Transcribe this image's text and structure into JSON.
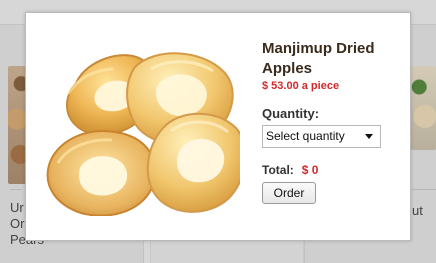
{
  "modal": {
    "product": {
      "title": "Manjimup Dried Apples",
      "price": "$ 53.00 a piece",
      "image_alt": "dried apple rings"
    },
    "quantity": {
      "label": "Quantity:",
      "placeholder": "Select quantity"
    },
    "total": {
      "label": "Total:",
      "value": "$ 0"
    },
    "order_button": "Order"
  },
  "background": {
    "left_title": "Ur\nOr\nPears",
    "right_title": "ut"
  },
  "colors": {
    "price": "#d22a2a",
    "title": "#3a2b1d"
  }
}
